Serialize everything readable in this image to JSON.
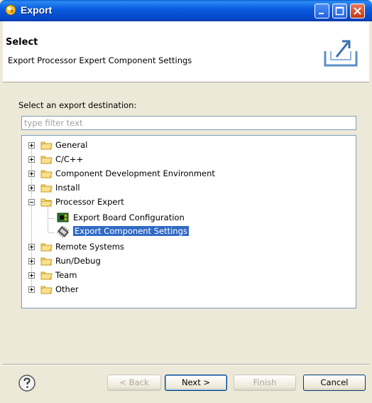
{
  "window": {
    "title": "Export"
  },
  "header": {
    "title": "Select",
    "description": "Export Processor Expert Component Settings"
  },
  "destination_label": "Select an export destination:",
  "filter": {
    "placeholder": "type filter text",
    "value": ""
  },
  "tree": {
    "items": [
      {
        "label": "General",
        "expanded": false,
        "icon": "folder-icon"
      },
      {
        "label": "C/C++",
        "expanded": false,
        "icon": "folder-icon"
      },
      {
        "label": "Component Development Environment",
        "expanded": false,
        "icon": "folder-icon"
      },
      {
        "label": "Install",
        "expanded": false,
        "icon": "folder-icon"
      },
      {
        "label": "Processor Expert",
        "expanded": true,
        "icon": "folder-icon",
        "children": [
          {
            "label": "Export Board Configuration",
            "icon": "board-icon",
            "selected": false
          },
          {
            "label": "Export Component Settings",
            "icon": "component-icon",
            "selected": true
          }
        ]
      },
      {
        "label": "Remote Systems",
        "expanded": false,
        "icon": "folder-icon"
      },
      {
        "label": "Run/Debug",
        "expanded": false,
        "icon": "folder-icon"
      },
      {
        "label": "Team",
        "expanded": false,
        "icon": "folder-icon"
      },
      {
        "label": "Other",
        "expanded": false,
        "icon": "folder-icon"
      }
    ]
  },
  "buttons": {
    "back": "< Back",
    "next": "Next >",
    "finish": "Finish",
    "cancel": "Cancel"
  },
  "colors": {
    "titlebar": "#0a5fd8",
    "selection": "#316ac5",
    "dialog_bg": "#ece9d8"
  }
}
